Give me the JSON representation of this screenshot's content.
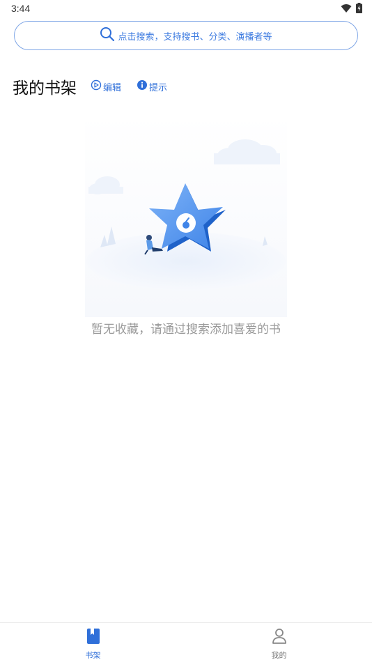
{
  "status_bar": {
    "time": "3:44",
    "icons": [
      "wifi-icon",
      "battery-charging-icon"
    ]
  },
  "search": {
    "placeholder": "点击搜索，支持搜书、分类、演播者等",
    "icon": "search-icon"
  },
  "header": {
    "title": "我的书架",
    "edit_label": "编辑",
    "hint_label": "提示",
    "accent_color": "#2f6fd9"
  },
  "empty_state": {
    "message": "暂无收藏，请通过搜索添加喜爱的书"
  },
  "bottom_nav": {
    "tabs": [
      {
        "label": "书架",
        "icon": "bookshelf-icon",
        "active": true
      },
      {
        "label": "我的",
        "icon": "profile-icon",
        "active": false
      }
    ]
  }
}
